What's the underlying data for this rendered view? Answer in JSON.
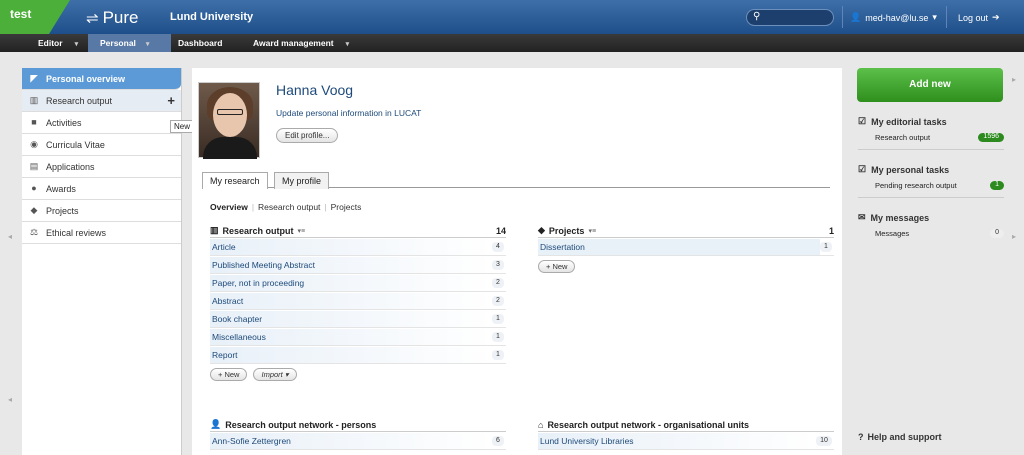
{
  "env": "test",
  "brand": "Pure",
  "university": "Lund University",
  "user": "med-hav@lu.se",
  "logout": "Log out",
  "nav": [
    {
      "label": "Editor"
    },
    {
      "label": "Personal"
    },
    {
      "label": "Dashboard"
    },
    {
      "label": "Award management"
    }
  ],
  "sidebar": {
    "items": [
      {
        "label": "Personal overview"
      },
      {
        "label": "Research output"
      },
      {
        "label": "Activities"
      },
      {
        "label": "Curricula Vitae"
      },
      {
        "label": "Applications"
      },
      {
        "label": "Awards"
      },
      {
        "label": "Projects"
      },
      {
        "label": "Ethical reviews"
      }
    ],
    "tooltip": "New",
    "plus": "+"
  },
  "profile": {
    "name": "Hanna Voog",
    "update_link": "Update personal information in LUCAT",
    "edit_button": "Edit profile..."
  },
  "tabs": [
    "My research",
    "My profile"
  ],
  "subnav": {
    "overview": "Overview",
    "research_output": "Research output",
    "projects": "Projects",
    "sep": "|"
  },
  "research_output": {
    "title": "Research output",
    "count": "14",
    "rows": [
      {
        "label": "Article",
        "n": "4"
      },
      {
        "label": "Published Meeting Abstract",
        "n": "3"
      },
      {
        "label": "Paper, not in proceeding",
        "n": "2"
      },
      {
        "label": "Abstract",
        "n": "2"
      },
      {
        "label": "Book chapter",
        "n": "1"
      },
      {
        "label": "Miscellaneous",
        "n": "1"
      },
      {
        "label": "Report",
        "n": "1"
      }
    ],
    "new_btn": "New",
    "import_btn": "Import"
  },
  "projects": {
    "title": "Projects",
    "count": "1",
    "rows": [
      {
        "label": "Dissertation",
        "n": "1"
      }
    ],
    "new_btn": "New"
  },
  "network_persons": {
    "title": "Research output network - persons",
    "rows": [
      {
        "label": "Ann-Sofie Zettergren",
        "n": "6"
      }
    ]
  },
  "network_units": {
    "title": "Research output network - organisational units",
    "rows": [
      {
        "label": "Lund University Libraries",
        "n": "10"
      }
    ]
  },
  "right": {
    "add_new": "Add new",
    "editorial": {
      "title": "My editorial tasks",
      "row": "Research output",
      "n": "1596"
    },
    "personal": {
      "title": "My personal tasks",
      "row": "Pending research output",
      "n": "1"
    },
    "messages": {
      "title": "My messages",
      "row": "Messages",
      "n": "0"
    },
    "help": "Help and support"
  },
  "colors": {
    "green": "#2f8f1d",
    "blue": "#1d4a7a",
    "active": "#5b9ad6"
  }
}
